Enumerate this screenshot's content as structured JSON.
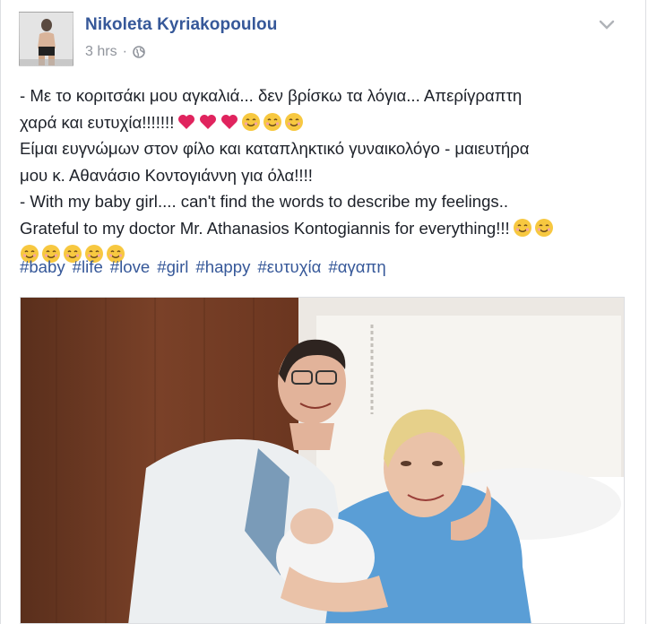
{
  "post": {
    "author_name": "Nikoleta Kyriakopoulou",
    "timestamp": "3 hrs",
    "separator": "·",
    "privacy_icon": "globe-icon",
    "menu_icon": "chevron-down-icon",
    "text_lines": [
      "- Με το κοριτσάκι μου αγκαλιά... δεν βρίσκω τα λόγια... Απερίγραπτη",
      "χαρά και ευτυχία!!!!!!!",
      "Είμαι ευγνώμων στον φίλο και καταπληκτικό γυναικολόγο - μαιευτήρα",
      "μου κ. Αθανάσιο Κοντογιάννη για όλα!!!!",
      "- With my baby girl.... can't find the words to describe my feelings..",
      "Grateful to my doctor Mr. Athanasios Kontogiannis for everything!!!"
    ],
    "emoji": {
      "heart": "red-heart-emoji",
      "smile": "smiling-face-emoji"
    },
    "hashtags": [
      "#baby",
      "#life",
      "#love",
      "#girl",
      "#happy",
      "#ευτυχία",
      "#αγαπη"
    ]
  },
  "colors": {
    "author_link": "#365899",
    "meta_gray": "#90949c",
    "text": "#1d2129",
    "heart_red": "#e0245e",
    "emoji_yellow": "#f7c840"
  }
}
